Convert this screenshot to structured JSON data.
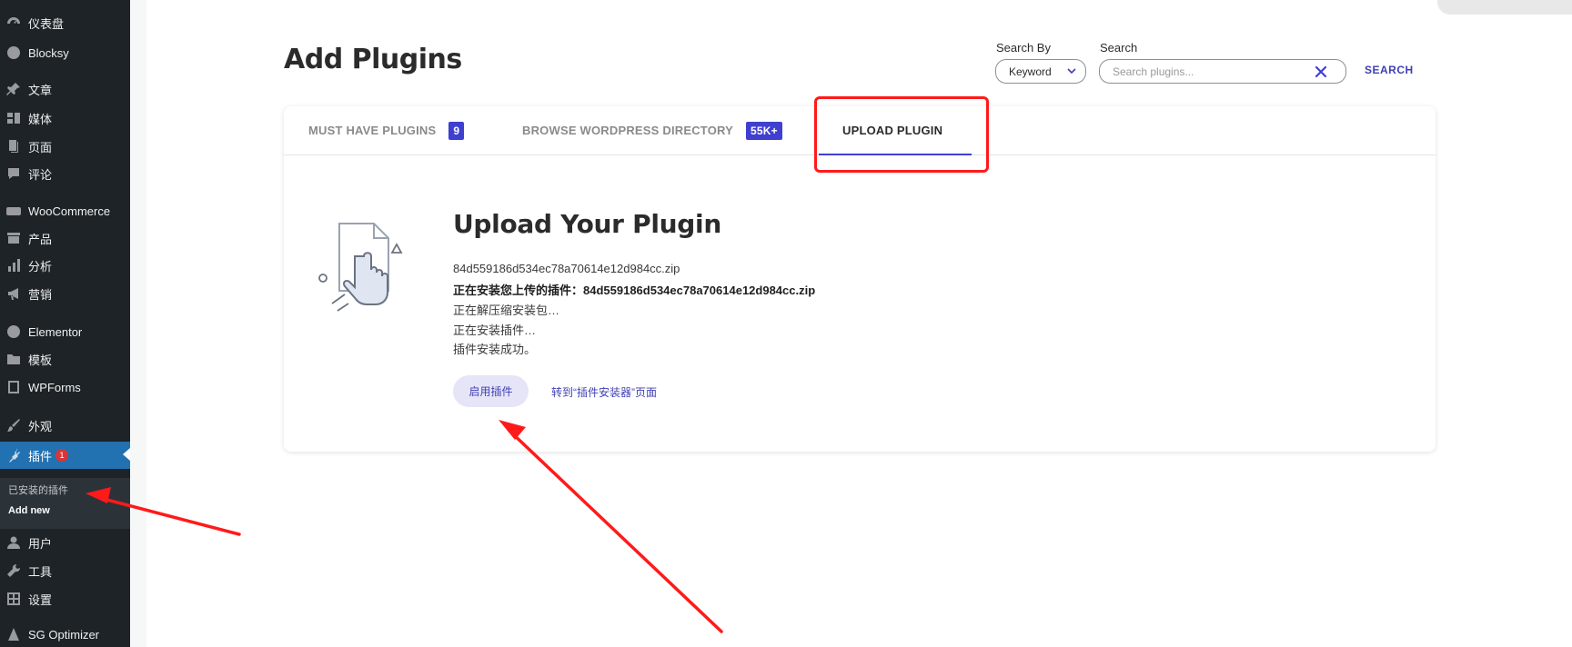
{
  "sidebar": {
    "items": [
      {
        "label": "仪表盘",
        "icon": "dashboard-icon"
      },
      {
        "label": "Blocksy",
        "icon": "blocksy-icon"
      },
      {
        "label": "文章",
        "icon": "pin-icon"
      },
      {
        "label": "媒体",
        "icon": "media-icon"
      },
      {
        "label": "页面",
        "icon": "page-icon"
      },
      {
        "label": "评论",
        "icon": "comment-icon"
      },
      {
        "label": "WooCommerce",
        "icon": "woocommerce-icon"
      },
      {
        "label": "产品",
        "icon": "archive-icon"
      },
      {
        "label": "分析",
        "icon": "chart-bar-icon"
      },
      {
        "label": "营销",
        "icon": "megaphone-icon"
      },
      {
        "label": "Elementor",
        "icon": "elementor-icon"
      },
      {
        "label": "模板",
        "icon": "folder-icon"
      },
      {
        "label": "WPForms",
        "icon": "wpforms-icon"
      },
      {
        "label": "外观",
        "icon": "brush-icon"
      },
      {
        "label": "插件",
        "icon": "plugin-icon",
        "badge": "1"
      },
      {
        "label": "用户",
        "icon": "user-icon"
      },
      {
        "label": "工具",
        "icon": "wrench-icon"
      },
      {
        "label": "设置",
        "icon": "settings-icon"
      },
      {
        "label": "SG Optimizer",
        "icon": "sg-optimizer-icon"
      }
    ],
    "submenu": {
      "installed": "已安装的插件",
      "add_new": "Add new"
    }
  },
  "header": {
    "title": "Add Plugins",
    "search_by_label": "Search By",
    "search_by_value": "Keyword",
    "search_label": "Search",
    "search_placeholder": "Search plugins...",
    "search_button": "SEARCH"
  },
  "tabs": [
    {
      "label": "MUST HAVE PLUGINS",
      "count": "9"
    },
    {
      "label": "BROWSE WORDPRESS DIRECTORY",
      "count": "55K+"
    },
    {
      "label": "UPLOAD PLUGIN",
      "active": true
    }
  ],
  "upload": {
    "heading": "Upload Your Plugin",
    "log": [
      "84d559186d534ec78a70614e12d984cc.zip",
      "正在安装您上传的插件：84d559186d534ec78a70614e12d984cc.zip",
      "正在解压缩安装包…",
      "正在安装插件…",
      "插件安装成功。"
    ],
    "activate_button": "启用插件",
    "goto_link": "转到“插件安装器”页面"
  },
  "colors": {
    "sidebar_bg": "#1d2327",
    "sidebar_active": "#2271b1",
    "accent": "#3f3fd0",
    "annotation_red": "#ff1a1a"
  }
}
